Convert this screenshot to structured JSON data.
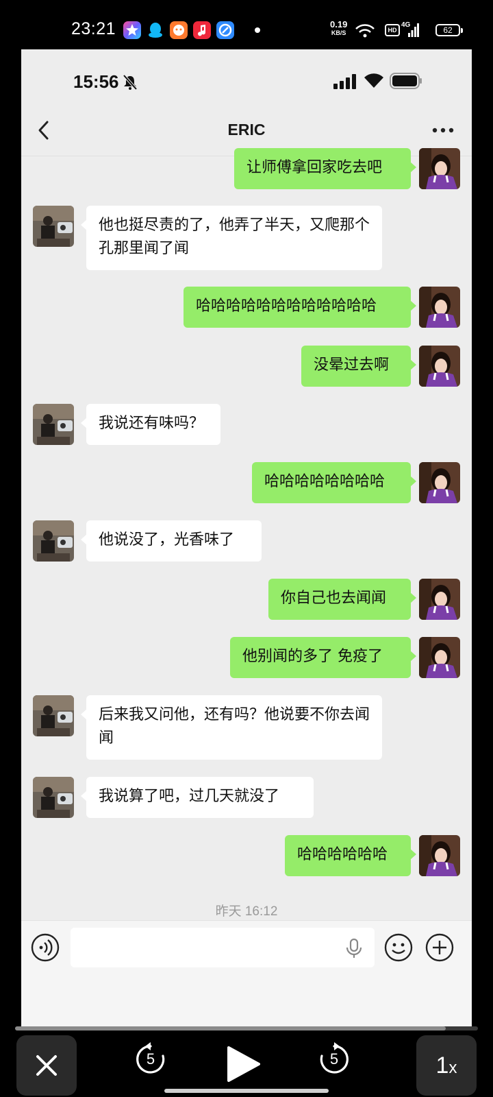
{
  "device_status": {
    "time": "23:21",
    "net_speed_value": "0.19",
    "net_speed_unit": "KB/S",
    "hd_label": "HD",
    "network_label": "4G",
    "battery_level": "62",
    "app_icons": [
      "star-app-icon",
      "qq-penguin-icon",
      "chat-app-icon",
      "music-app-icon",
      "browser-app-icon"
    ]
  },
  "inner_status": {
    "time": "15:56"
  },
  "chat": {
    "title": "ERIC",
    "timestamp": "昨天 16:12",
    "messages": [
      {
        "sender": "me",
        "text": "让师傅拿回家吃去吧"
      },
      {
        "sender": "them",
        "text": "他也挺尽责的了，他弄了半天，又爬那个孔那里闻了闻"
      },
      {
        "sender": "me",
        "text": "哈哈哈哈哈哈哈哈哈哈哈哈"
      },
      {
        "sender": "me",
        "text": "没晕过去啊"
      },
      {
        "sender": "them",
        "text": "我说还有味吗？"
      },
      {
        "sender": "me",
        "text": "哈哈哈哈哈哈哈哈"
      },
      {
        "sender": "them",
        "text": "他说没了，光香味了"
      },
      {
        "sender": "me",
        "text": "你自己也去闻闻"
      },
      {
        "sender": "me",
        "text": "他别闻的多了 免疫了"
      },
      {
        "sender": "them",
        "text": "后来我又问他，还有吗？他说要不你去闻闻"
      },
      {
        "sender": "them",
        "text": "我说算了吧，过几天就没了"
      },
      {
        "sender": "me",
        "text": "哈哈哈哈哈哈"
      }
    ]
  },
  "player": {
    "skip_back_seconds": "5",
    "skip_forward_seconds": "5",
    "speed_value": "1",
    "speed_suffix": "x",
    "progress_fraction": 0.93
  },
  "colors": {
    "my_bubble": "#95ec69",
    "their_bubble": "#ffffff",
    "chat_background": "#ededed"
  }
}
